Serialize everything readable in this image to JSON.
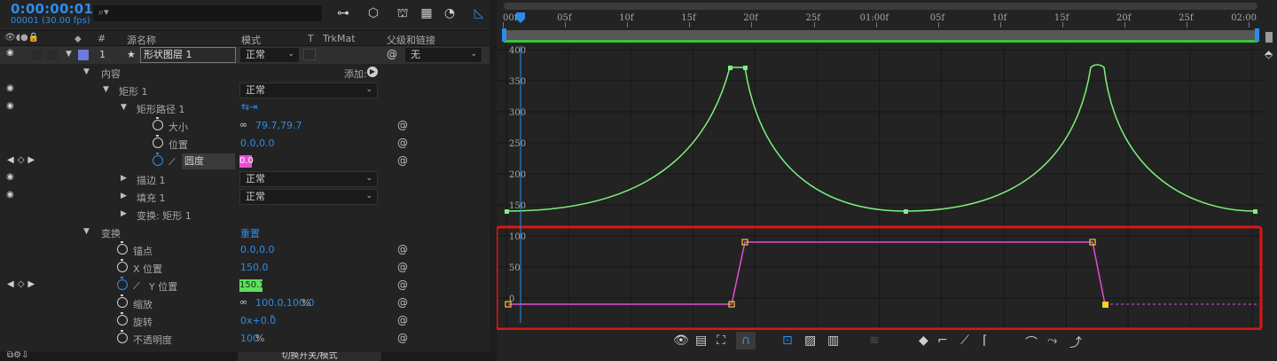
{
  "app": {
    "timecode": "0:00:00:01",
    "fps": "00001 (30.00 fps)",
    "search_icon": "search-icon"
  },
  "columns": {
    "num": "#",
    "source": "源名称",
    "mode": "模式",
    "t": "T",
    "trkmat": "TrkMat",
    "parent": "父级和链接"
  },
  "layer": {
    "index": "1",
    "name": "形状图层 1",
    "mode": "正常",
    "parent": "无"
  },
  "rows": {
    "content": "内容",
    "add": "添加:",
    "rect": "矩形 1",
    "rect_mode": "正常",
    "rect_path": "矩形路径 1",
    "size_label": "大小",
    "size_value": "79.7,79.7",
    "position_label": "位置",
    "position_value": "0.0,0.0",
    "roundness_label": "圆度",
    "roundness_value": "0.0",
    "stroke": "描边 1",
    "stroke_mode": "正常",
    "fill": "填充 1",
    "fill_mode": "正常",
    "transform_rect": "变换: 矩形 1",
    "transform": "变换",
    "reset": "重置",
    "anchor_label": "锚点",
    "anchor_value": "0.0,0.0",
    "xpos_label": "X 位置",
    "xpos_value": "150.0",
    "ypos_label": "Y 位置",
    "ypos_value": "150.1",
    "scale_label": "缩放",
    "scale_value": "100.0,100.0",
    "scale_unit": "%",
    "rotation_label": "旋转",
    "rotation_value": "0x+0.0",
    "rotation_unit": "°",
    "opacity_label": "不透明度",
    "opacity_value": "100",
    "opacity_unit": "%"
  },
  "bottom": {
    "toggle": "切换开关/模式"
  },
  "ruler": {
    "ticks": [
      "00f",
      "05f",
      "10f",
      "15f",
      "20f",
      "25f",
      "01:00f",
      "05f",
      "10f",
      "15f",
      "20f",
      "25f",
      "02:00"
    ]
  },
  "graph": {
    "value_labels": [
      "400",
      "350",
      "300",
      "250",
      "200",
      "150"
    ],
    "speed_labels": [
      "100",
      "50",
      "0"
    ]
  },
  "colors": {
    "accent_blue": "#2d8ceb",
    "value_curve": "#7cf07c",
    "speed_curve": "#e24fd0",
    "highlight_box": "#e01414",
    "roundness_bg": "#e24fd0",
    "ypos_bg": "#5ee05e"
  }
}
